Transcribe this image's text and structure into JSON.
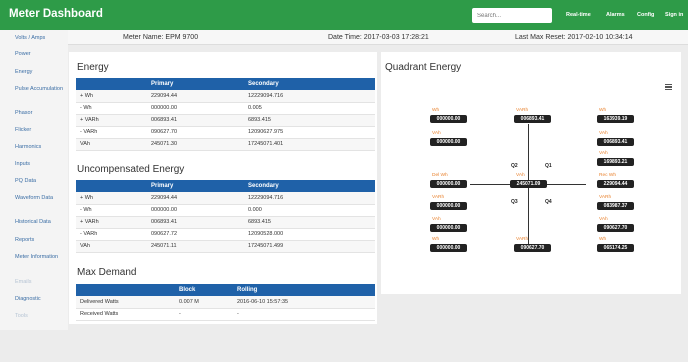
{
  "header": {
    "title": "Meter Dashboard",
    "search_placeholder": "Search...",
    "nav": [
      "Real-time",
      "Alarms",
      "Config",
      "Sign in"
    ]
  },
  "sidebar": {
    "items": [
      "Volts / Amps",
      "Power",
      "Energy",
      "Pulse Accumulation",
      "Phasor",
      "Flicker",
      "Harmonics",
      "Inputs",
      "PQ Data",
      "Waveform Data",
      "Historical Data",
      "Reports",
      "Meter Information",
      "Emails",
      "Diagnostic",
      "Tools"
    ]
  },
  "infobar": {
    "meter_name": "Meter Name: EPM 9700",
    "date_time": "Date Time: 2017-03-03 17:28:21",
    "last_reset": "Last Max Reset: 2017-02-10 10:34:14"
  },
  "energy": {
    "title": "Energy",
    "headers": [
      "",
      "Primary",
      "Secondary"
    ],
    "rows": [
      [
        "+ Wh",
        "229094.44",
        "12229094.716"
      ],
      [
        "- Wh",
        "000000.00",
        "0.005"
      ],
      [
        "+ VARh",
        "006893.41",
        "6893.415"
      ],
      [
        "- VARh",
        "090627.70",
        "12090627.975"
      ],
      [
        "VAh",
        "245071.30",
        "17245071.401"
      ]
    ]
  },
  "uncompensated": {
    "title": "Uncompensated Energy",
    "headers": [
      "",
      "Primary",
      "Secondary"
    ],
    "rows": [
      [
        "+ Wh",
        "229094.44",
        "12229094.716"
      ],
      [
        "- Wh",
        "000000.00",
        "0.000"
      ],
      [
        "+ VARh",
        "006893.41",
        "6893.415"
      ],
      [
        "- VARh",
        "090627.72",
        "12090528.000"
      ],
      [
        "VAh",
        "245071.11",
        "17245071.499"
      ]
    ]
  },
  "max_demand": {
    "title": "Max Demand",
    "headers": [
      "",
      "Block",
      "Rolling"
    ],
    "rows": [
      [
        "Delivered Watts",
        "0.007 M",
        "2016-06-10 15:57:35"
      ],
      [
        "Received Watts",
        "-",
        "-"
      ]
    ]
  },
  "quadrant": {
    "title": "Quadrant Energy",
    "tags": {
      "q1": "Q1",
      "q2": "Q2",
      "q3": "Q3",
      "q4": "Q4"
    },
    "cells": [
      {
        "label": "Wh",
        "value": "000000.00"
      },
      {
        "label": "VARh",
        "value": "006893.41"
      },
      {
        "label": "Wh",
        "value": "163939.19"
      },
      {
        "label": "VAh",
        "value": "000000.00"
      },
      {
        "label": "VAh",
        "value": "006893.41"
      },
      {
        "label": "VAh",
        "value": "169893.21"
      },
      {
        "label": "Del Wh",
        "value": "000000.00"
      },
      {
        "label": "VAh",
        "value": "245071.09"
      },
      {
        "label": "Rec Wh",
        "value": "229094.44"
      },
      {
        "label": "VARh",
        "value": "000000.00"
      },
      {
        "label": "VARh",
        "value": "083987.37"
      },
      {
        "label": "VAh",
        "value": "000000.00"
      },
      {
        "label": "VAh",
        "value": "090627.70"
      },
      {
        "label": "Wh",
        "value": "000000.00"
      },
      {
        "label": "VARh",
        "value": "090627.70"
      },
      {
        "label": "Wh",
        "value": "065174.25"
      }
    ]
  }
}
